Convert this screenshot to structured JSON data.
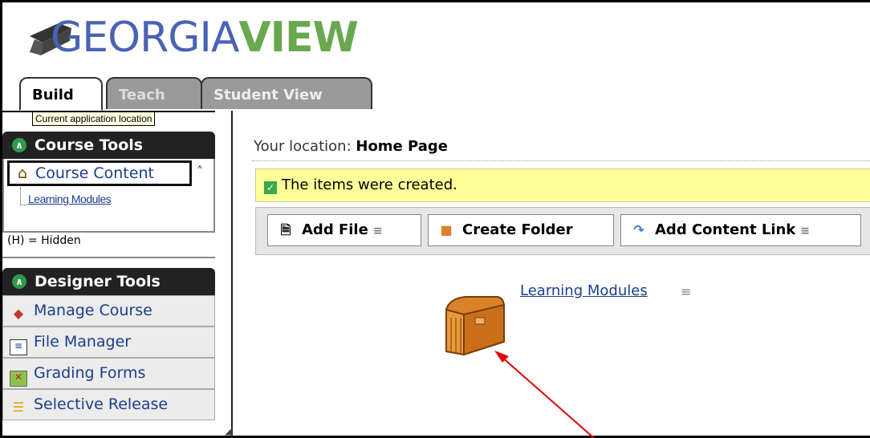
{
  "logo": {
    "text_main": "GEORGIA",
    "text_accent": "VIEW"
  },
  "tabs": [
    {
      "label": "Build",
      "active": true
    },
    {
      "label": "Teach",
      "active": false
    },
    {
      "label": "Student View",
      "active": false
    }
  ],
  "tooltip": "Current application location",
  "left_nav": {
    "course_tools": {
      "title": "Course Tools",
      "course_content": "Course Content",
      "children": [
        "Learning Modules"
      ]
    },
    "hidden_note": "(H) = Hidden",
    "designer_tools": {
      "title": "Designer Tools",
      "items": [
        {
          "label": "Manage Course",
          "icon": "toolbox-icon"
        },
        {
          "label": "File Manager",
          "icon": "file-manager-icon"
        },
        {
          "label": "Grading Forms",
          "icon": "grading-forms-icon"
        },
        {
          "label": "Selective Release",
          "icon": "selective-release-icon"
        }
      ]
    }
  },
  "main": {
    "location_label": "Your location:",
    "location_value": "Home Page",
    "alert": "The items were created.",
    "toolbar": {
      "add_file": "Add File",
      "create_folder": "Create Folder",
      "add_content_link": "Add Content Link"
    },
    "content_item": "Learning Modules"
  },
  "colors": {
    "link": "#1a3e8c",
    "alert_bg": "#ffff99",
    "panel_head": "#222222",
    "check": "#3aa84a",
    "annotation_arrow": "#e00000"
  }
}
